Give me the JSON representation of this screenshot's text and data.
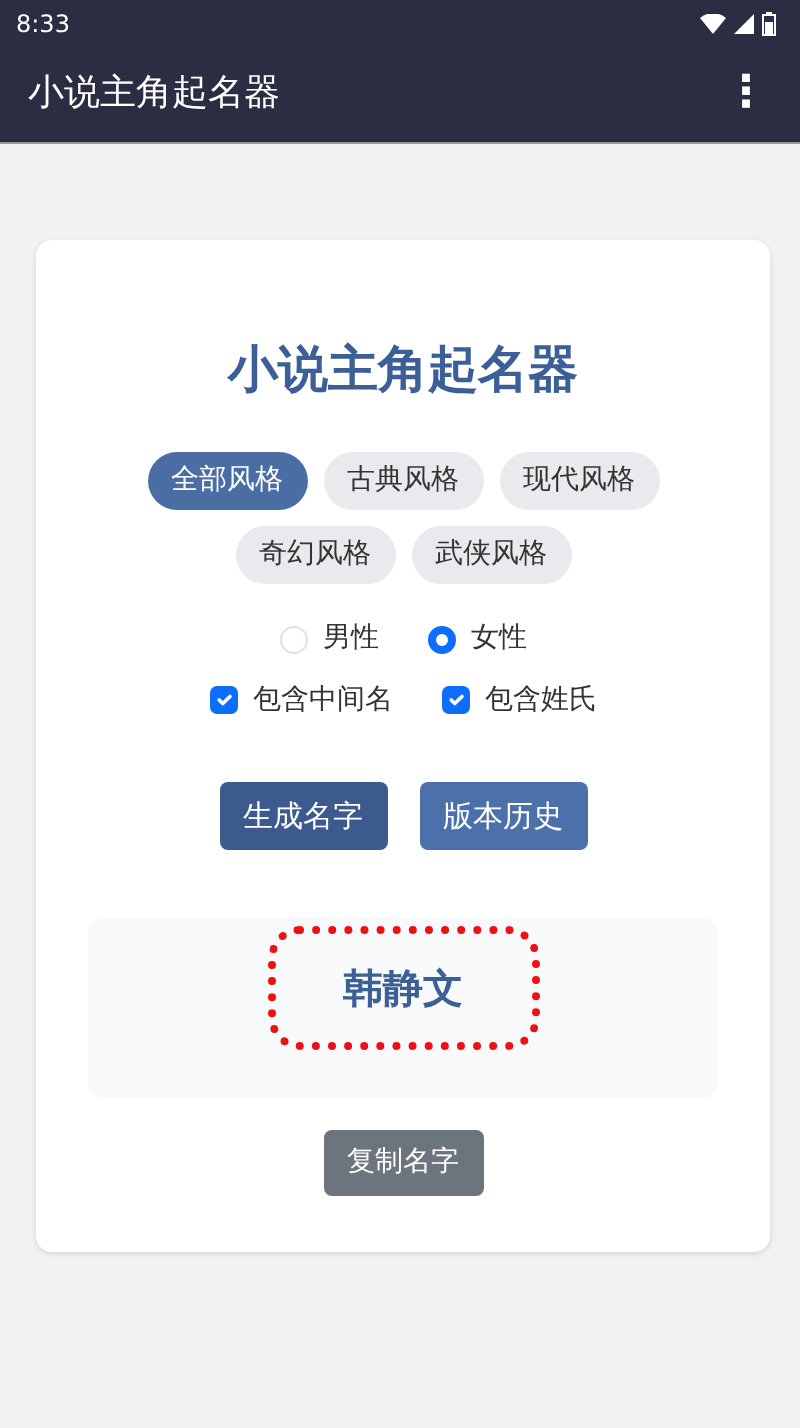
{
  "status_bar": {
    "time": "8:33"
  },
  "app_bar": {
    "title": "小说主角起名器",
    "menu": "⋮"
  },
  "card": {
    "title": "小说主角起名器",
    "styles": [
      {
        "label": "全部风格",
        "selected": true
      },
      {
        "label": "古典风格",
        "selected": false
      },
      {
        "label": "现代风格",
        "selected": false
      },
      {
        "label": "奇幻风格",
        "selected": false
      },
      {
        "label": "武侠风格",
        "selected": false
      }
    ],
    "genders": [
      {
        "label": "男性",
        "selected": false
      },
      {
        "label": "女性",
        "selected": true
      }
    ],
    "options": [
      {
        "label": "包含中间名",
        "checked": true
      },
      {
        "label": "包含姓氏",
        "checked": true
      }
    ],
    "buttons": [
      {
        "label": "生成名字",
        "kind": "primary"
      },
      {
        "label": "版本历史",
        "kind": "secondary"
      }
    ],
    "result": {
      "name": "韩静文",
      "highlighted": true
    },
    "copy_button": "复制名字"
  }
}
